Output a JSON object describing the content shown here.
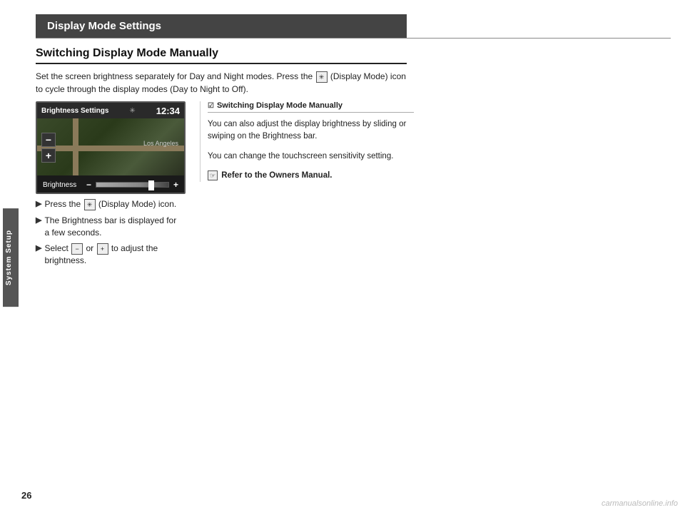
{
  "page": {
    "number": "26"
  },
  "sidebar": {
    "label": "System Setup"
  },
  "header": {
    "title": "Display Mode Settings"
  },
  "section": {
    "heading": "Switching Display Mode Manually",
    "intro": "Set the screen brightness separately for Day and Night modes. Press the  (Display Mode) icon to cycle through the display modes (Day to Night to Off)."
  },
  "steps": {
    "step1": "Press the  (Display Mode) icon.",
    "step2_label": "The Brightness bar is displayed for a few seconds.",
    "step3_label": "Select  or  to adjust the brightness."
  },
  "screen": {
    "title": "Brightness Settings",
    "time": "12:34",
    "brightness_label": "Brightness",
    "city": "Los Angeles"
  },
  "info_box": {
    "title": "Switching Display Mode Manually",
    "text1": "You can also adjust the display brightness by sliding or swiping on the Brightness bar.",
    "text2": "You can change the touchscreen sensitivity setting.",
    "refer": "Refer to the Owners Manual."
  },
  "watermark": "carmanualsonline.info"
}
